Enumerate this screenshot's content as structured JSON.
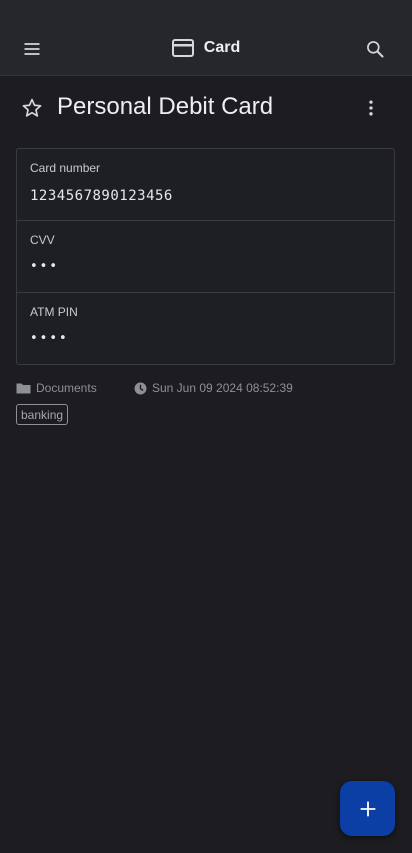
{
  "appbar": {
    "title": "Card"
  },
  "item": {
    "title": "Personal Debit Card",
    "fields": [
      {
        "label": "Card number",
        "value": "1234567890123456",
        "masked": false
      },
      {
        "label": "CVV",
        "value": "•••",
        "masked": true
      },
      {
        "label": "ATM PIN",
        "value": "••••",
        "masked": true
      }
    ],
    "folder": "Documents",
    "modified": "Sun Jun 09 2024 08:52:39",
    "tags": [
      "banking"
    ]
  },
  "icons": {
    "menu": "menu-icon",
    "card": "credit-card-icon",
    "search": "search-icon",
    "star": "star-outline-icon",
    "more": "more-vert-icon",
    "folder": "folder-icon",
    "clock": "clock-icon",
    "add": "add-icon"
  },
  "colors": {
    "background": "#1c1c21",
    "appbar": "#26272c",
    "fab": "#0b3fa6",
    "muted_text": "#8e9097"
  }
}
